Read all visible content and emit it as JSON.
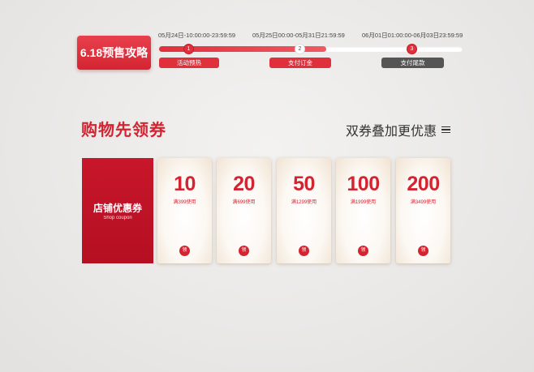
{
  "header": {
    "badge": "6.18预售攻略"
  },
  "timeline": {
    "dates": [
      "05月24日-10:00:00-23:59:59",
      "05月25日00:00-05月31日21:59:59",
      "06月01日01:00:00-06月03日23:59:59"
    ],
    "steps": [
      "1",
      "2",
      "3"
    ],
    "phases": [
      "活动预热",
      "支付订金",
      "支付尾款"
    ],
    "progress": 0.55
  },
  "section": {
    "title": "购物先领券",
    "subtitle": "双券叠加更优惠"
  },
  "shop_card": {
    "title": "店铺优惠券",
    "subtitle": "Shop coupon"
  },
  "coupons": [
    {
      "amount": "10",
      "condition": "满399使用",
      "claim": "领"
    },
    {
      "amount": "20",
      "condition": "满699使用",
      "claim": "领"
    },
    {
      "amount": "50",
      "condition": "满1299使用",
      "claim": "领"
    },
    {
      "amount": "100",
      "condition": "满1999使用",
      "claim": "领"
    },
    {
      "amount": "200",
      "condition": "满3499使用",
      "claim": "领"
    }
  ],
  "colors": {
    "accent": "#d42431",
    "shop_card": "#c8162a",
    "phase_inactive": "#555555"
  }
}
